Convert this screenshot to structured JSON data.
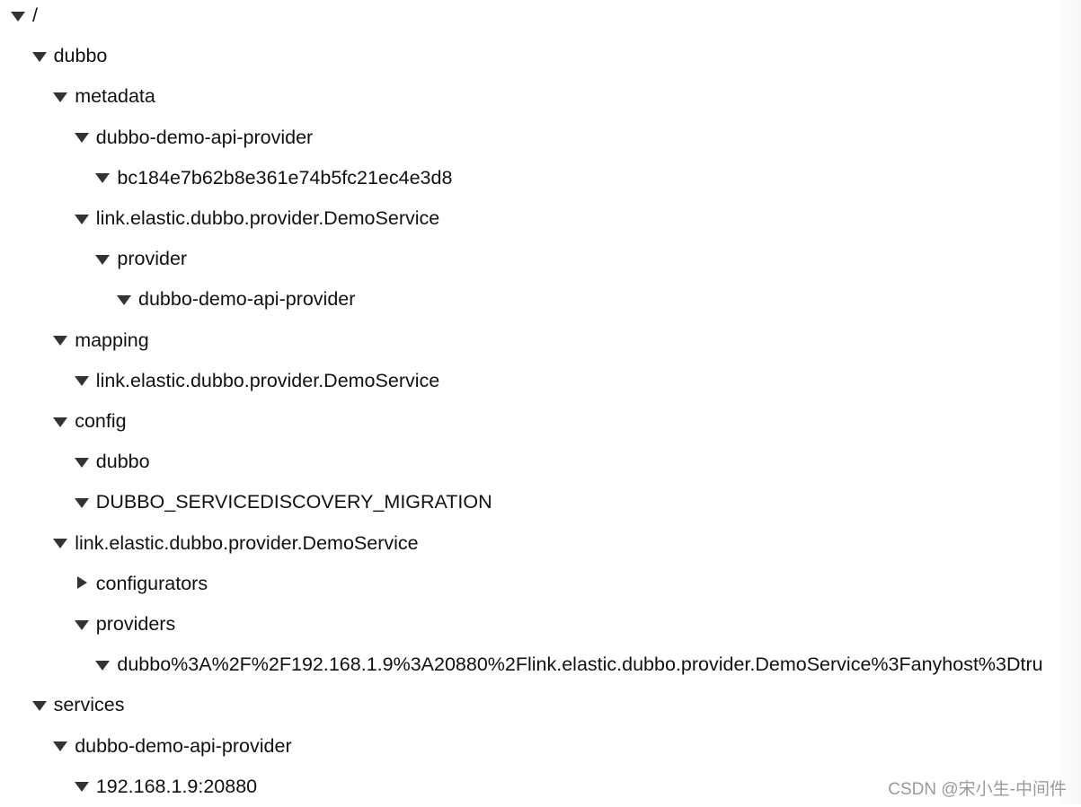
{
  "tree": [
    {
      "label": "/",
      "level": 0,
      "expanded": true
    },
    {
      "label": "dubbo",
      "level": 1,
      "expanded": true
    },
    {
      "label": "metadata",
      "level": 2,
      "expanded": true
    },
    {
      "label": "dubbo-demo-api-provider",
      "level": 3,
      "expanded": true
    },
    {
      "label": "bc184e7b62b8e361e74b5fc21ec4e3d8",
      "level": 4,
      "expanded": true
    },
    {
      "label": "link.elastic.dubbo.provider.DemoService",
      "level": 3,
      "expanded": true
    },
    {
      "label": "provider",
      "level": 4,
      "expanded": true
    },
    {
      "label": "dubbo-demo-api-provider",
      "level": 5,
      "expanded": true
    },
    {
      "label": "mapping",
      "level": 2,
      "expanded": true
    },
    {
      "label": "link.elastic.dubbo.provider.DemoService",
      "level": 3,
      "expanded": true
    },
    {
      "label": "config",
      "level": 2,
      "expanded": true
    },
    {
      "label": "dubbo",
      "level": 3,
      "expanded": true
    },
    {
      "label": "DUBBO_SERVICEDISCOVERY_MIGRATION",
      "level": 3,
      "expanded": true
    },
    {
      "label": "link.elastic.dubbo.provider.DemoService",
      "level": 2,
      "expanded": true
    },
    {
      "label": "configurators",
      "level": 3,
      "expanded": false
    },
    {
      "label": "providers",
      "level": 3,
      "expanded": true
    },
    {
      "label": "dubbo%3A%2F%2F192.168.1.9%3A20880%2Flink.elastic.dubbo.provider.DemoService%3Fanyhost%3Dtru",
      "level": 4,
      "expanded": true
    },
    {
      "label": "services",
      "level": 1,
      "expanded": true
    },
    {
      "label": "dubbo-demo-api-provider",
      "level": 2,
      "expanded": true
    },
    {
      "label": "192.168.1.9:20880",
      "level": 3,
      "expanded": true
    }
  ],
  "watermark": "CSDN @宋小生-中间件"
}
